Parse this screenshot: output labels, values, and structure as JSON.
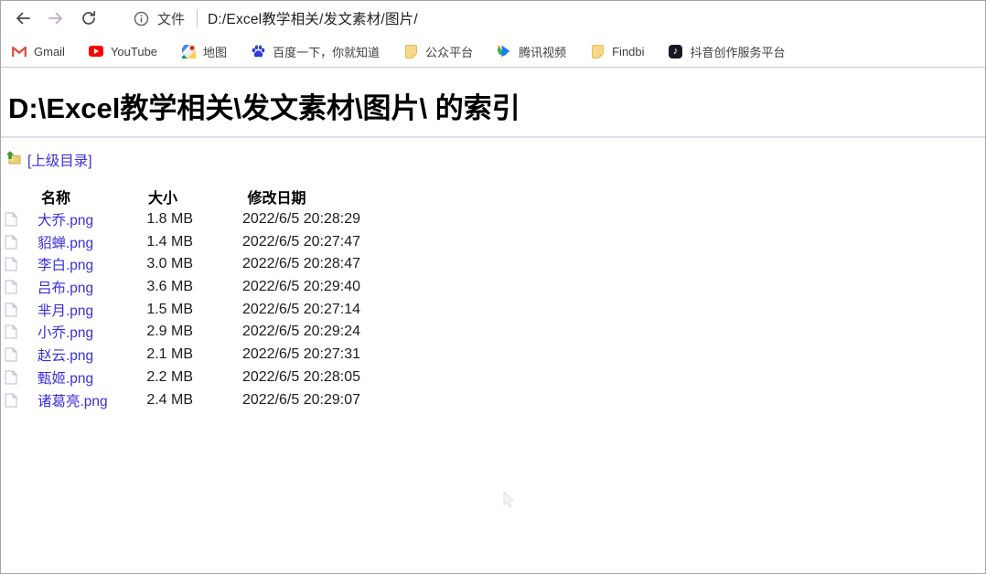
{
  "toolbar": {
    "file_label": "文件",
    "url": "D:/Excel教学相关/发文素材/图片/"
  },
  "bookmarks": [
    {
      "label": "Gmail",
      "icon": "gmail-icon"
    },
    {
      "label": "YouTube",
      "icon": "youtube-icon"
    },
    {
      "label": "地图",
      "icon": "google-maps-icon"
    },
    {
      "label": "百度一下，你就知道",
      "icon": "baidu-icon"
    },
    {
      "label": "公众平台",
      "icon": "yellow-doc-icon"
    },
    {
      "label": "腾讯视频",
      "icon": "tencent-video-icon"
    },
    {
      "label": "Findbi",
      "icon": "yellow-doc-icon"
    },
    {
      "label": "抖音创作服务平台",
      "icon": "douyin-icon",
      "note_glyph": "♪"
    }
  ],
  "page": {
    "title": "D:\\Excel教学相关\\发文素材\\图片\\ 的索引",
    "parent_link": "[上级目录]"
  },
  "table": {
    "headers": {
      "name": "名称",
      "size": "大小",
      "date": "修改日期"
    },
    "rows": [
      {
        "name": "大乔.png",
        "size": "1.8 MB",
        "date": "2022/6/5 20:28:29"
      },
      {
        "name": "貂蝉.png",
        "size": "1.4 MB",
        "date": "2022/6/5 20:27:47"
      },
      {
        "name": "李白.png",
        "size": "3.0 MB",
        "date": "2022/6/5 20:28:47"
      },
      {
        "name": "吕布.png",
        "size": "3.6 MB",
        "date": "2022/6/5 20:29:40"
      },
      {
        "name": "芈月.png",
        "size": "1.5 MB",
        "date": "2022/6/5 20:27:14"
      },
      {
        "name": "小乔.png",
        "size": "2.9 MB",
        "date": "2022/6/5 20:29:24"
      },
      {
        "name": "赵云.png",
        "size": "2.1 MB",
        "date": "2022/6/5 20:27:31"
      },
      {
        "name": "甄姬.png",
        "size": "2.2 MB",
        "date": "2022/6/5 20:28:05"
      },
      {
        "name": "诸葛亮.png",
        "size": "2.4 MB",
        "date": "2022/6/5 20:29:07"
      }
    ]
  },
  "colors": {
    "link": "#3a30d8",
    "rule": "#d9ddf0",
    "youtube_red": "#ff0000",
    "gmail_red": "#e2483d",
    "baidu_blue": "#2c3cdd",
    "douyin_black": "#161823",
    "doc_yellow": "#f5d88a"
  }
}
